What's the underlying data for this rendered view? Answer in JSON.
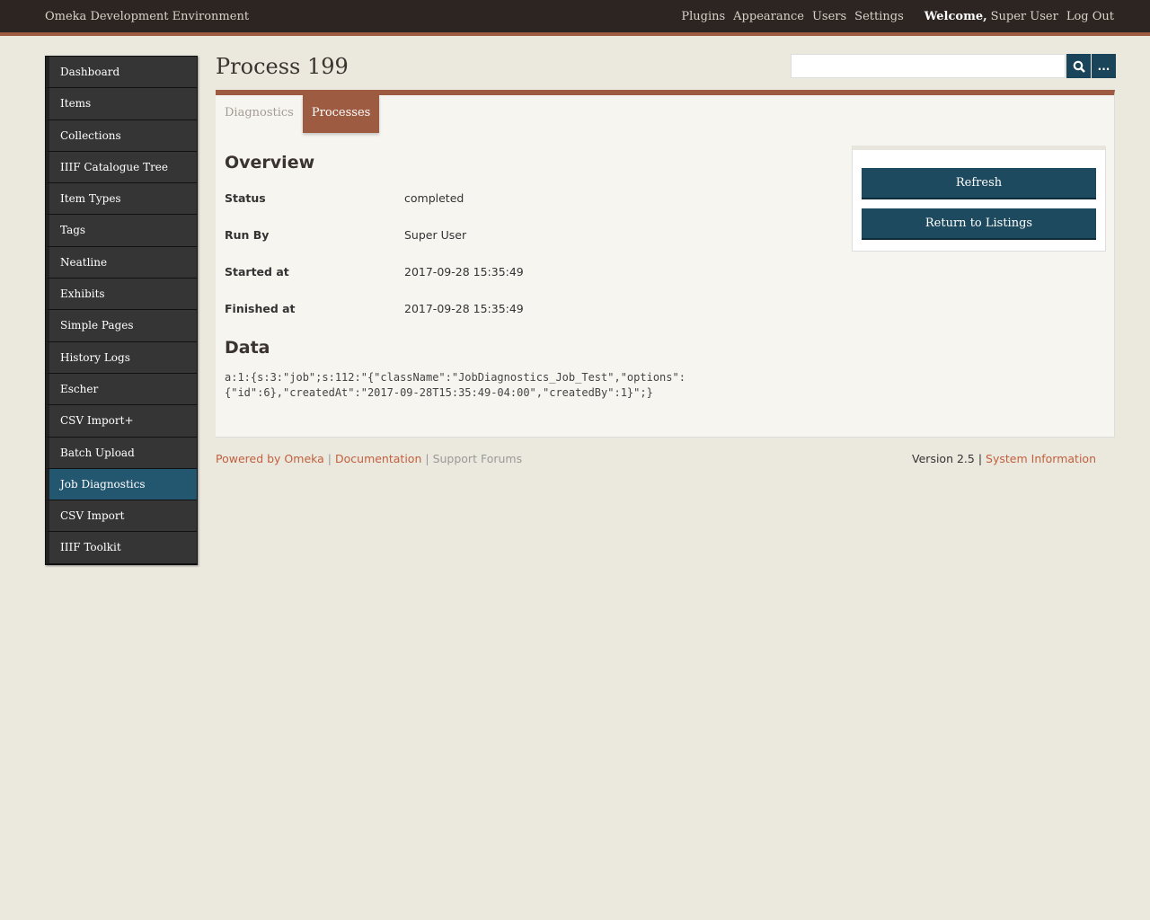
{
  "header": {
    "site_title": "Omeka Development Environment",
    "nav": [
      "Plugins",
      "Appearance",
      "Users",
      "Settings"
    ],
    "welcome": "Welcome,",
    "user": "Super User",
    "logout": "Log Out"
  },
  "sidebar": {
    "items": [
      "Dashboard",
      "Items",
      "Collections",
      "IIIF Catalogue Tree",
      "Item Types",
      "Tags",
      "Neatline",
      "Exhibits",
      "Simple Pages",
      "History Logs",
      "Escher",
      "CSV Import+",
      "Batch Upload",
      "Job Diagnostics",
      "CSV Import",
      "IIIF Toolkit"
    ],
    "active": "Job Diagnostics"
  },
  "page_title": "Process 199",
  "search": {
    "value": "",
    "advanced": "..."
  },
  "tabs": [
    "Diagnostics",
    "Processes"
  ],
  "overview": {
    "heading": "Overview",
    "rows": [
      {
        "label": "Status",
        "value": "completed"
      },
      {
        "label": "Run By",
        "value": "Super User"
      },
      {
        "label": "Started at",
        "value": "2017-09-28 15:35:49"
      },
      {
        "label": "Finished at",
        "value": "2017-09-28 15:35:49"
      }
    ]
  },
  "data": {
    "heading": "Data",
    "line1": "a:1:{s:3:\"job\";s:112:\"{\"className\":\"JobDiagnostics_Job_Test\",\"options\":",
    "line2": "{\"id\":6},\"createdAt\":\"2017-09-28T15:35:49-04:00\",\"createdBy\":1}\";}"
  },
  "actions": {
    "refresh": "Refresh",
    "return": "Return to Listings"
  },
  "footer": {
    "powered": "Powered by Omeka",
    "docs": "Documentation",
    "forums": "Support Forums",
    "version": "Version 2.5",
    "sysinfo": "System Information",
    "sep": "|"
  }
}
